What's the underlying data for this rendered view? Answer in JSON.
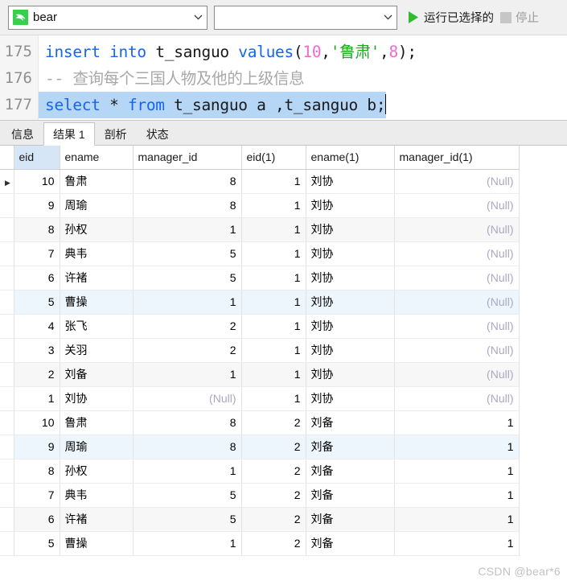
{
  "toolbar": {
    "connection_value": "bear",
    "connection_icon": "mysql-dolphin-icon",
    "schema_value": "",
    "run_selected_label": "运行已选择的",
    "run_icon": "play-triangle-icon",
    "stop_label": "停止",
    "stop_icon": "stop-square-icon",
    "dropdown_icon": "chevron-down-icon"
  },
  "editor": {
    "lines": [
      {
        "number": "175",
        "selected": false,
        "tokens": [
          {
            "t": "insert",
            "c": "kw"
          },
          {
            "t": " ",
            "c": "plain"
          },
          {
            "t": "into",
            "c": "kw"
          },
          {
            "t": " ",
            "c": "plain"
          },
          {
            "t": "t_sanguo",
            "c": "plain"
          },
          {
            "t": " ",
            "c": "plain"
          },
          {
            "t": "values",
            "c": "kw"
          },
          {
            "t": "(",
            "c": "punc"
          },
          {
            "t": "10",
            "c": "num"
          },
          {
            "t": ",",
            "c": "punc"
          },
          {
            "t": "'鲁肃'",
            "c": "str"
          },
          {
            "t": ",",
            "c": "punc"
          },
          {
            "t": "8",
            "c": "num"
          },
          {
            "t": ");",
            "c": "punc"
          }
        ]
      },
      {
        "number": "176",
        "selected": false,
        "tokens": [
          {
            "t": "-- 查询每个三国人物及他的上级信息",
            "c": "cmt"
          }
        ]
      },
      {
        "number": "177",
        "selected": true,
        "tokens": [
          {
            "t": "select",
            "c": "kw"
          },
          {
            "t": " * ",
            "c": "punc"
          },
          {
            "t": "from",
            "c": "kw"
          },
          {
            "t": " t_sanguo a ,t_sanguo b;",
            "c": "plain"
          }
        ]
      }
    ]
  },
  "tabs": [
    {
      "label": "信息",
      "active": false
    },
    {
      "label": "结果 1",
      "active": true
    },
    {
      "label": "剖析",
      "active": false
    },
    {
      "label": "状态",
      "active": false
    }
  ],
  "grid": {
    "columns": [
      {
        "key": "eid",
        "label": "eid",
        "cls": "c-eid",
        "selected": true
      },
      {
        "key": "ename",
        "label": "ename",
        "cls": "c-ename",
        "selected": false
      },
      {
        "key": "manager_id",
        "label": "manager_id",
        "cls": "c-mid",
        "selected": false
      },
      {
        "key": "eid1",
        "label": "eid(1)",
        "cls": "c-eid1",
        "selected": false
      },
      {
        "key": "ename1",
        "label": "ename(1)",
        "cls": "c-ename1",
        "selected": false
      },
      {
        "key": "manager_id1",
        "label": "manager_id(1)",
        "cls": "c-mid1",
        "selected": false
      }
    ],
    "null_text": "(Null)",
    "current_row_marker": "▶",
    "rows": [
      {
        "current": true,
        "stripe": "",
        "cells": [
          "10",
          "鲁肃",
          "8",
          "1",
          "刘协",
          "(Null)"
        ]
      },
      {
        "current": false,
        "stripe": "",
        "cells": [
          "9",
          "周瑜",
          "8",
          "1",
          "刘协",
          "(Null)"
        ]
      },
      {
        "current": false,
        "stripe": "gray",
        "cells": [
          "8",
          "孙权",
          "1",
          "1",
          "刘协",
          "(Null)"
        ]
      },
      {
        "current": false,
        "stripe": "",
        "cells": [
          "7",
          "典韦",
          "5",
          "1",
          "刘协",
          "(Null)"
        ]
      },
      {
        "current": false,
        "stripe": "",
        "cells": [
          "6",
          "许褚",
          "5",
          "1",
          "刘协",
          "(Null)"
        ]
      },
      {
        "current": false,
        "stripe": "blue",
        "cells": [
          "5",
          "曹操",
          "1",
          "1",
          "刘协",
          "(Null)"
        ]
      },
      {
        "current": false,
        "stripe": "",
        "cells": [
          "4",
          "张飞",
          "2",
          "1",
          "刘协",
          "(Null)"
        ]
      },
      {
        "current": false,
        "stripe": "",
        "cells": [
          "3",
          "关羽",
          "2",
          "1",
          "刘协",
          "(Null)"
        ]
      },
      {
        "current": false,
        "stripe": "gray",
        "cells": [
          "2",
          "刘备",
          "1",
          "1",
          "刘协",
          "(Null)"
        ]
      },
      {
        "current": false,
        "stripe": "",
        "cells": [
          "1",
          "刘协",
          "(Null)",
          "1",
          "刘协",
          "(Null)"
        ]
      },
      {
        "current": false,
        "stripe": "",
        "cells": [
          "10",
          "鲁肃",
          "8",
          "2",
          "刘备",
          "1"
        ]
      },
      {
        "current": false,
        "stripe": "blue",
        "cells": [
          "9",
          "周瑜",
          "8",
          "2",
          "刘备",
          "1"
        ]
      },
      {
        "current": false,
        "stripe": "",
        "cells": [
          "8",
          "孙权",
          "1",
          "2",
          "刘备",
          "1"
        ]
      },
      {
        "current": false,
        "stripe": "",
        "cells": [
          "7",
          "典韦",
          "5",
          "2",
          "刘备",
          "1"
        ]
      },
      {
        "current": false,
        "stripe": "gray",
        "cells": [
          "6",
          "许褚",
          "5",
          "2",
          "刘备",
          "1"
        ]
      },
      {
        "current": false,
        "stripe": "",
        "cells": [
          "5",
          "曹操",
          "1",
          "2",
          "刘备",
          "1"
        ]
      }
    ]
  },
  "watermark": "CSDN @bear*6"
}
